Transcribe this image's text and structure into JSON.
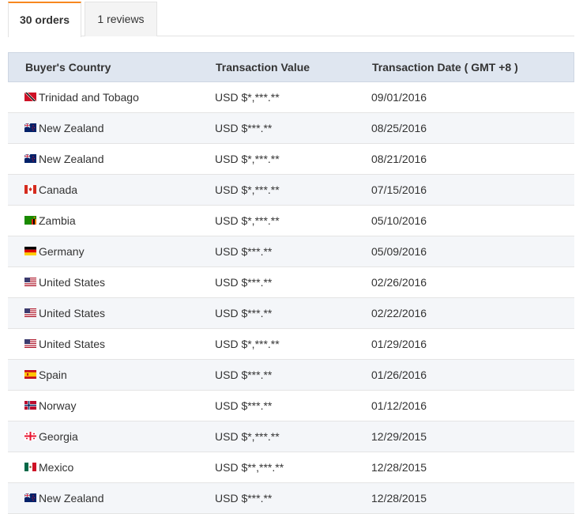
{
  "tabs": [
    {
      "label": "30 orders",
      "active": true
    },
    {
      "label": "1 reviews",
      "active": false
    }
  ],
  "table": {
    "headers": [
      "Buyer's Country",
      "Transaction Value",
      "Transaction Date ( GMT +8 )"
    ],
    "rows": [
      {
        "flag": "tt-flag-icon",
        "country": "Trinidad and Tobago",
        "value": "USD $*,***.**",
        "date": "09/01/2016"
      },
      {
        "flag": "nz-flag-icon",
        "country": "New Zealand",
        "value": "USD $***.**",
        "date": "08/25/2016"
      },
      {
        "flag": "nz-flag-icon",
        "country": "New Zealand",
        "value": "USD $*,***.**",
        "date": "08/21/2016"
      },
      {
        "flag": "ca-flag-icon",
        "country": "Canada",
        "value": "USD $*,***.**",
        "date": "07/15/2016"
      },
      {
        "flag": "zm-flag-icon",
        "country": "Zambia",
        "value": "USD $*,***.**",
        "date": "05/10/2016"
      },
      {
        "flag": "de-flag-icon",
        "country": "Germany",
        "value": "USD $***.**",
        "date": "05/09/2016"
      },
      {
        "flag": "us-flag-icon",
        "country": "United States",
        "value": "USD $***.**",
        "date": "02/26/2016"
      },
      {
        "flag": "us-flag-icon",
        "country": "United States",
        "value": "USD $***.**",
        "date": "02/22/2016"
      },
      {
        "flag": "us-flag-icon",
        "country": "United States",
        "value": "USD $*,***.**",
        "date": "01/29/2016"
      },
      {
        "flag": "es-flag-icon",
        "country": "Spain",
        "value": "USD $***.**",
        "date": "01/26/2016"
      },
      {
        "flag": "no-flag-icon",
        "country": "Norway",
        "value": "USD $***.**",
        "date": "01/12/2016"
      },
      {
        "flag": "ge-flag-icon",
        "country": "Georgia",
        "value": "USD $*,***.**",
        "date": "12/29/2015"
      },
      {
        "flag": "mx-flag-icon",
        "country": "Mexico",
        "value": "USD $**,***.**",
        "date": "12/28/2015"
      },
      {
        "flag": "nz-flag-icon",
        "country": "New Zealand",
        "value": "USD $***.**",
        "date": "12/28/2015"
      }
    ]
  },
  "colors": {
    "active_tab_accent": "#f7871f",
    "header_bg": "#dfe6f0",
    "alt_row_bg": "#f4f6f9"
  }
}
